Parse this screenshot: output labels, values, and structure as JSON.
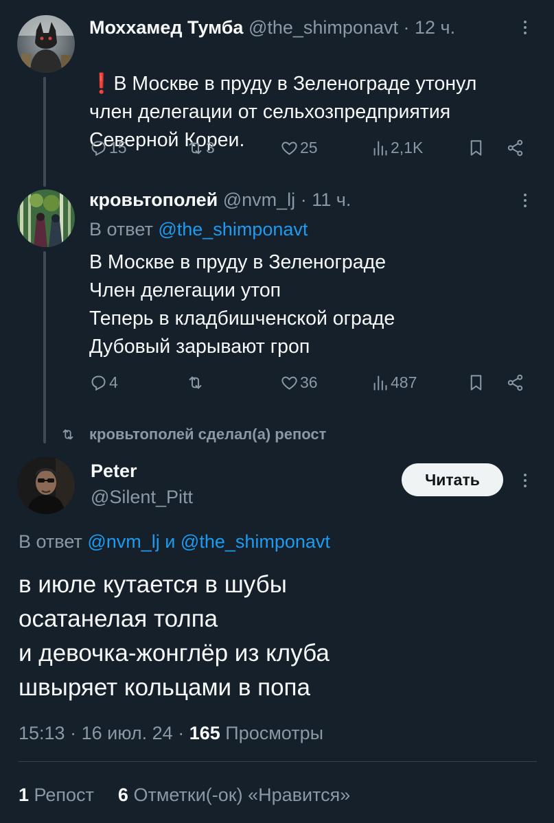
{
  "tweet1": {
    "name": "Мохxамед Тумба",
    "handle": "@the_shimponavt",
    "dot": "·",
    "time": "12 ч.",
    "emoji": "❗",
    "text": "В Москве в пруду в Зеленограде утонул\nчлен делегации от сельхозпредприятия\nСеверной Кореи.",
    "replies": "15",
    "reposts": "3",
    "likes": "25",
    "views": "2,1K"
  },
  "tweet2": {
    "name": "кровьтополей",
    "handle": "@nvm_lj",
    "dot": "·",
    "time": "11 ч.",
    "reply_prefix": "В ответ",
    "reply_handle": "@the_shimponavt",
    "text": "В Москве в пруду в Зеленограде\nЧлен делегации утоп\nТеперь в кладбишченской ограде\nДубовый зарывают гроп",
    "replies": "4",
    "reposts": "",
    "likes": "36",
    "views": "487"
  },
  "repost_notice": "кровьтополей сделал(а) репост",
  "main_tweet": {
    "name": "Peter",
    "handle": "@Silent_Pitt",
    "follow_label": "Читать",
    "reply_prefix": "В ответ",
    "reply_handle_1": "@nvm_lj",
    "reply_and": "и",
    "reply_handle_2": "@the_shimponavt",
    "text": "в июле кутается в шубы\nосатанелая толпа\nи девочка-жонглёр из клуба\nшвыряет кольцами в попа",
    "time": "15:13",
    "dot": "·",
    "date": "16 июл. 24",
    "views_count": "165",
    "views_label": "Просмотры",
    "reposts_count": "1",
    "reposts_label": "Репост",
    "likes_count": "6",
    "likes_label": "Отметки(-ок) «Нравится»"
  },
  "colors": {
    "background": "#15202b",
    "text_primary": "#f7f9f9",
    "text_secondary": "#8b98a5",
    "link": "#1d9bf0",
    "emoji_red": "#e0245e",
    "button_bg": "#eff3f4"
  }
}
